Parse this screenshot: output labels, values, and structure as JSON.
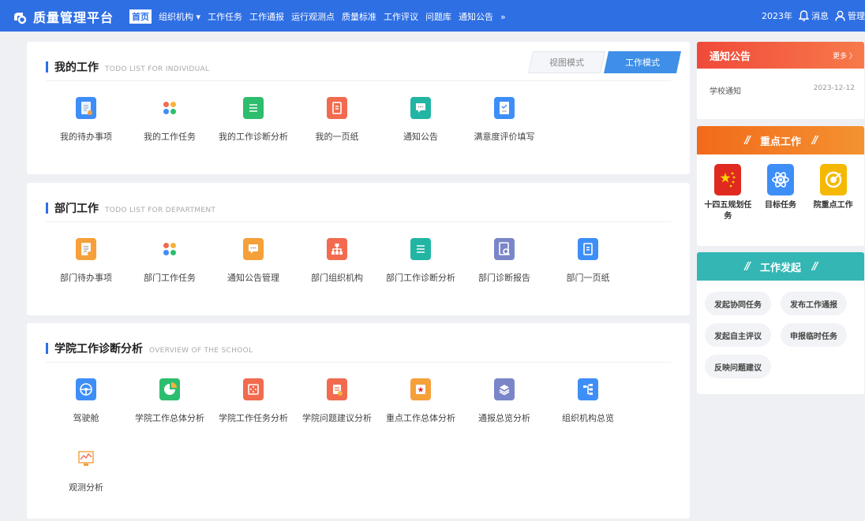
{
  "header": {
    "app_title": "质量管理平台",
    "nav": [
      {
        "label": "首页",
        "active": true
      },
      {
        "label": "组织机构 ▾",
        "active": false
      },
      {
        "label": "工作任务",
        "active": false
      },
      {
        "label": "工作通报",
        "active": false
      },
      {
        "label": "运行观测点",
        "active": false
      },
      {
        "label": "质量标准",
        "active": false
      },
      {
        "label": "工作评议",
        "active": false
      },
      {
        "label": "问题库",
        "active": false
      },
      {
        "label": "通知公告",
        "active": false
      },
      {
        "label": "»",
        "active": false
      }
    ],
    "year": "2023年",
    "messages": "消息",
    "user": "管理"
  },
  "my_work": {
    "title": "我的工作",
    "subtitle": "TODO LIST FOR INDIVIDUAL",
    "mode_view": "视图模式",
    "mode_work": "工作模式",
    "tiles": [
      {
        "label": "我的待办事项",
        "color": "#3e8ef7",
        "icon": "todo-icon"
      },
      {
        "label": "我的工作任务",
        "color": "#f5b33a",
        "icon": "tasks-grid-icon"
      },
      {
        "label": "我的工作诊断分析",
        "color": "#2dbd6e",
        "icon": "list-icon"
      },
      {
        "label": "我的一页纸",
        "color": "#f26b4f",
        "icon": "page-icon"
      },
      {
        "label": "通知公告",
        "color": "#22b5a3",
        "icon": "announce-icon"
      },
      {
        "label": "满意度评价填写",
        "color": "#3e8ef7",
        "icon": "survey-icon"
      }
    ]
  },
  "dept_work": {
    "title": "部门工作",
    "subtitle": "TODO LIST FOR DEPARTMENT",
    "tiles": [
      {
        "label": "部门待办事项",
        "color": "#f5a03a",
        "icon": "todo-icon"
      },
      {
        "label": "部门工作任务",
        "color": "#f5b33a",
        "icon": "tasks-grid-icon"
      },
      {
        "label": "通知公告管理",
        "color": "#f5a03a",
        "icon": "announce-icon"
      },
      {
        "label": "部门组织机构",
        "color": "#f26b4f",
        "icon": "org-icon"
      },
      {
        "label": "部门工作诊断分析",
        "color": "#22b5a3",
        "icon": "list-icon"
      },
      {
        "label": "部门诊断报告",
        "color": "#7a86c8",
        "icon": "report-icon"
      },
      {
        "label": "部门一页纸",
        "color": "#3e8ef7",
        "icon": "page-icon"
      }
    ]
  },
  "school_analysis": {
    "title": "学院工作诊断分析",
    "subtitle": "OVERVIEW OF THE SCHOOL",
    "tiles": [
      {
        "label": "驾驶舱",
        "color": "#3e8ef7",
        "icon": "dashboard-icon"
      },
      {
        "label": "学院工作总体分析",
        "color": "#2dbd6e",
        "icon": "pie-icon"
      },
      {
        "label": "学院工作任务分析",
        "color": "#f26b4f",
        "icon": "target-icon"
      },
      {
        "label": "学院问题建议分析",
        "color": "#f26b4f",
        "icon": "suggestion-icon"
      },
      {
        "label": "重点工作总体分析",
        "color": "#f5a03a",
        "icon": "star-doc-icon"
      },
      {
        "label": "通报总览分析",
        "color": "#7a86c8",
        "icon": "layers-icon"
      },
      {
        "label": "组织机构总览",
        "color": "#3e8ef7",
        "icon": "org-tree-icon"
      },
      {
        "label": "观测分析",
        "color": "#f5a03a",
        "icon": "monitor-icon"
      }
    ]
  },
  "notice": {
    "title": "通知公告",
    "more": "更多 〉",
    "items": [
      {
        "title": "学校通知",
        "date": "2023-12-12"
      }
    ]
  },
  "key_work": {
    "title": "重点工作",
    "items": [
      {
        "label": "十四五规划任务",
        "color": "#e02a1f",
        "icon": "flag-icon"
      },
      {
        "label": "目标任务",
        "color": "#3e8ef7",
        "icon": "atom-icon"
      },
      {
        "label": "院重点工作",
        "color": "#f5b800",
        "icon": "target-icon"
      }
    ]
  },
  "launch": {
    "title": "工作发起",
    "items": [
      "发起协同任务",
      "发布工作通报",
      "发起自主评议",
      "申报临时任务",
      "反映问题建议"
    ]
  }
}
